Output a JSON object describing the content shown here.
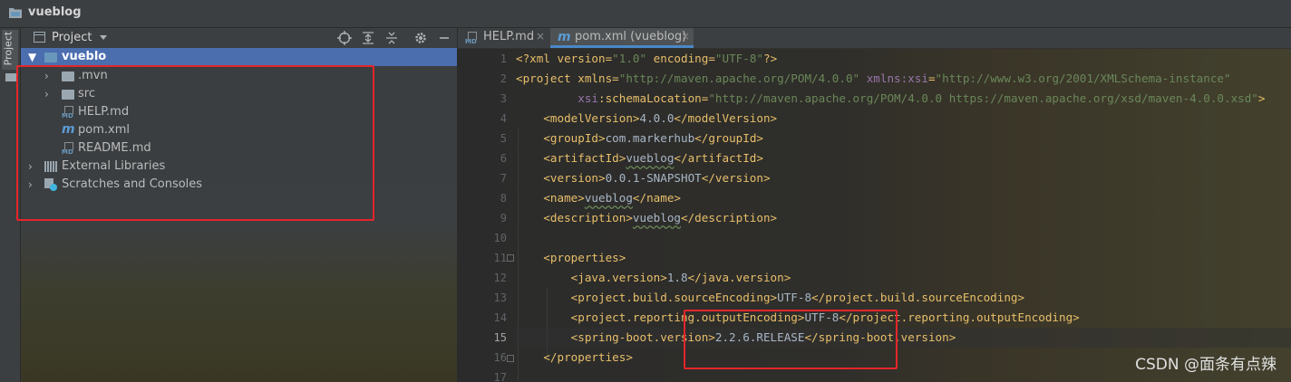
{
  "window": {
    "title": "vueblog"
  },
  "toolstrip": {
    "project_tab_label": "Project"
  },
  "panel": {
    "view_label": "Project",
    "tree": [
      {
        "label": "vueblo",
        "type": "module-folder",
        "expanded": true
      },
      {
        "label": ".mvn",
        "type": "folder",
        "expanded": false
      },
      {
        "label": "src",
        "type": "folder",
        "expanded": false
      },
      {
        "label": "HELP.md",
        "type": "markdown"
      },
      {
        "label": "pom.xml",
        "type": "maven"
      },
      {
        "label": "README.md",
        "type": "markdown"
      },
      {
        "label": "External Libraries",
        "type": "libraries",
        "expanded": false
      },
      {
        "label": "Scratches and Consoles",
        "type": "scratches",
        "expanded": false
      }
    ]
  },
  "editor": {
    "tabs": [
      {
        "label": "HELP.md",
        "active": false
      },
      {
        "label": "pom.xml (vueblog)",
        "active": true
      }
    ],
    "current_line": 15,
    "line_numbers": [
      "1",
      "2",
      "3",
      "4",
      "5",
      "6",
      "7",
      "8",
      "9",
      "10",
      "11",
      "12",
      "13",
      "14",
      "15",
      "16",
      "17"
    ],
    "code_lines": [
      "<?xml version=\"1.0\" encoding=\"UTF-8\"?>",
      "<project xmlns=\"http://maven.apache.org/POM/4.0.0\" xmlns:xsi=\"http://www.w3.org/2001/XMLSchema-instance\"",
      "         xsi:schemaLocation=\"http://maven.apache.org/POM/4.0.0 https://maven.apache.org/xsd/maven-4.0.0.xsd\">",
      "    <modelVersion>4.0.0</modelVersion>",
      "    <groupId>com.markerhub</groupId>",
      "    <artifactId>vueblog</artifactId>",
      "    <version>0.0.1-SNAPSHOT</version>",
      "    <name>vueblog</name>",
      "    <description>vueblog</description>",
      "",
      "    <properties>",
      "        <java.version>1.8</java.version>",
      "        <project.build.sourceEncoding>UTF-8</project.build.sourceEncoding>",
      "        <project.reporting.outputEncoding>UTF-8</project.reporting.outputEncoding>",
      "        <spring-boot.version>2.2.6.RELEASE</spring-boot.version>",
      "    </properties>",
      ""
    ]
  },
  "watermark": "CSDN @面条有点辣",
  "colors": {
    "highlight_box": "#e5252a",
    "selection": "#4b6eaf",
    "tag": "#e8bf6a",
    "string": "#6a8759",
    "text": "#a9b7c6"
  }
}
